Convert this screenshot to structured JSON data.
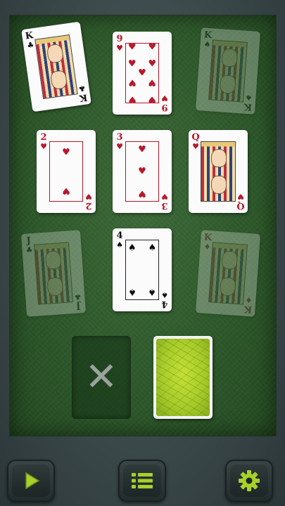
{
  "board": {
    "cards": [
      {
        "rank": "K",
        "suit": "♣",
        "color": "black",
        "faded": false,
        "face": true
      },
      {
        "rank": "9",
        "suit": "♥",
        "color": "red",
        "faded": false,
        "face": false
      },
      {
        "rank": "K",
        "suit": "♠",
        "color": "black",
        "faded": true,
        "face": true
      },
      {
        "rank": "2",
        "suit": "♥",
        "color": "red",
        "faded": false,
        "face": false
      },
      {
        "rank": "3",
        "suit": "♥",
        "color": "red",
        "faded": false,
        "face": false
      },
      {
        "rank": "Q",
        "suit": "♥",
        "color": "red",
        "faded": false,
        "face": true
      },
      {
        "rank": "J",
        "suit": "♣",
        "color": "black",
        "faded": true,
        "face": true
      },
      {
        "rank": "4",
        "suit": "♠",
        "color": "black",
        "faded": false,
        "face": false
      },
      {
        "rank": "K",
        "suit": "♦",
        "color": "red",
        "faded": true,
        "face": true
      }
    ]
  },
  "discard": {
    "icon": "x-icon",
    "glyph": "✕"
  },
  "deck": {
    "back_color": "#a8cc2a"
  },
  "toolbar": {
    "play_icon": "play-icon",
    "menu_icon": "menu-list-icon",
    "settings_icon": "gear-icon",
    "accent": "#a6d12a"
  }
}
